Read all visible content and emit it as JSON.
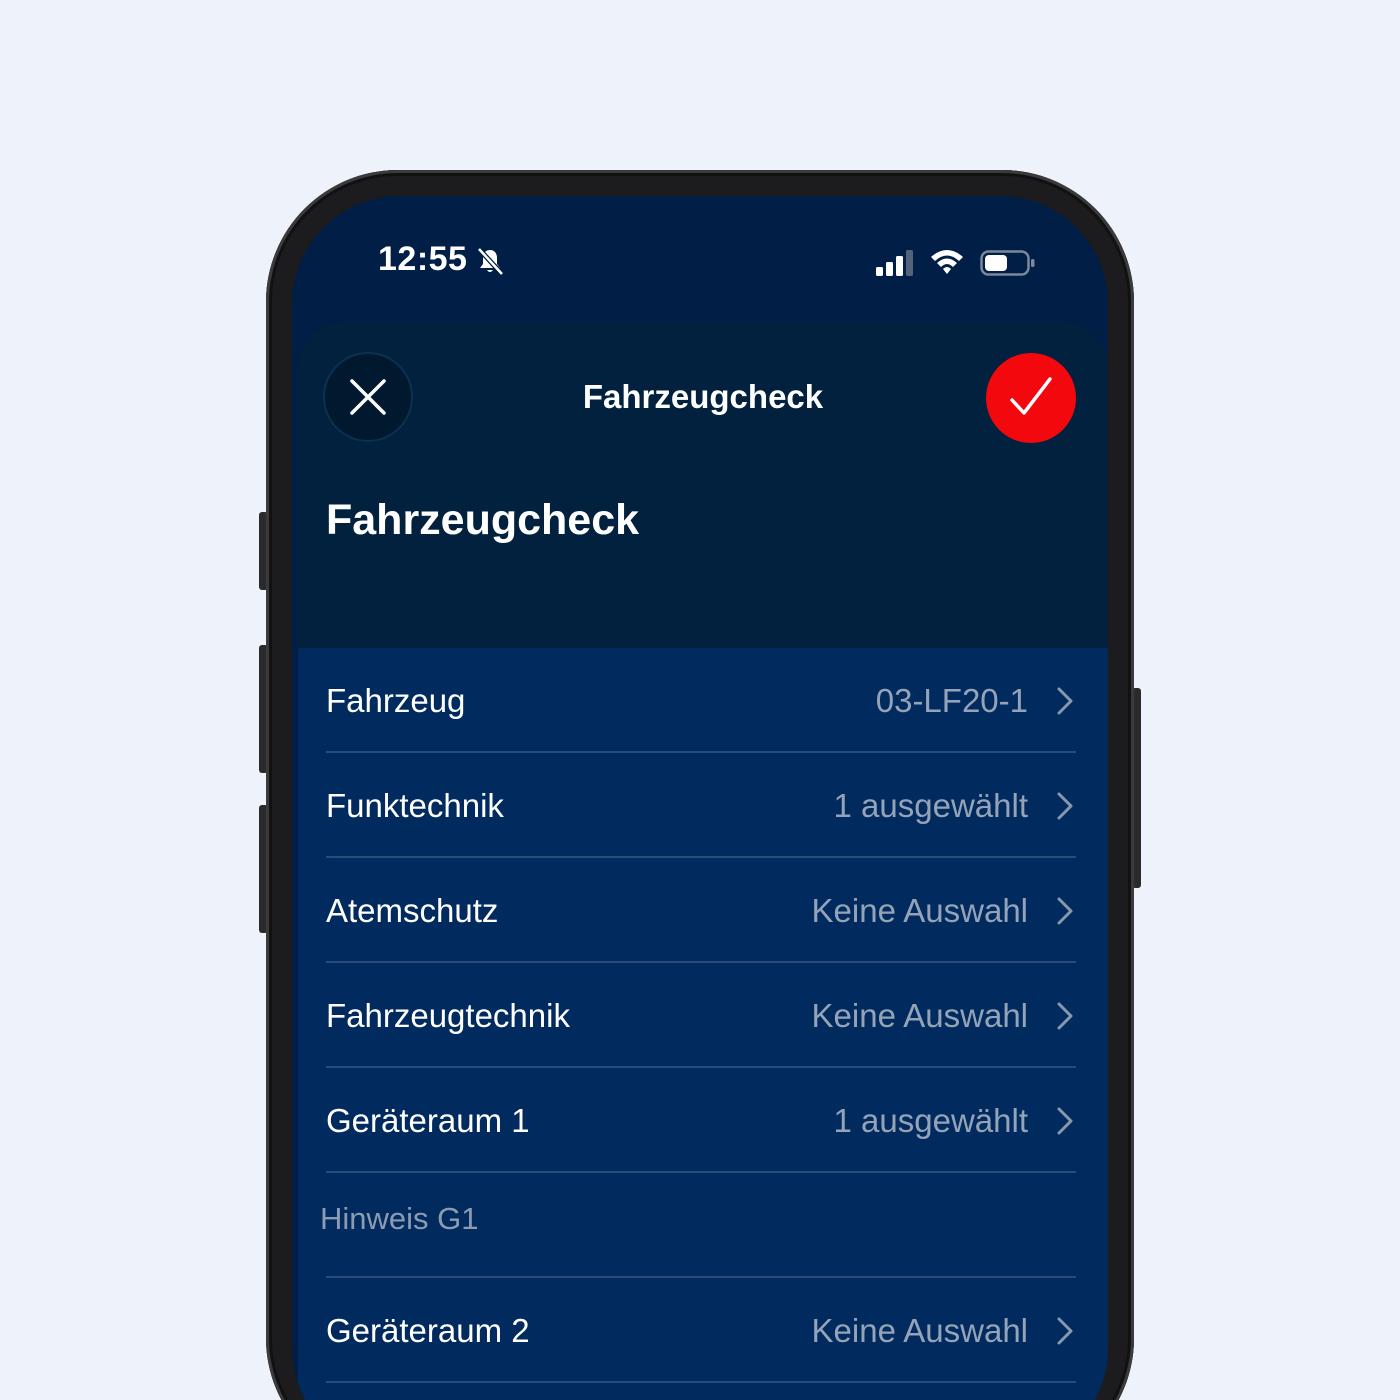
{
  "status_bar": {
    "time": "12:55"
  },
  "nav": {
    "title": "Fahrzeugcheck"
  },
  "page": {
    "title": "Fahrzeugcheck"
  },
  "rows": [
    {
      "label": "Fahrzeug",
      "value": "03-LF20-1"
    },
    {
      "label": "Funktechnik",
      "value": "1 ausgewählt"
    },
    {
      "label": "Atemschutz",
      "value": "Keine Auswahl"
    },
    {
      "label": "Fahrzeugtechnik",
      "value": "Keine Auswahl"
    },
    {
      "label": "Geräteraum 1",
      "value": "1 ausgewählt"
    }
  ],
  "note": {
    "placeholder": "Hinweis G1"
  },
  "rows2": [
    {
      "label": "Geräteraum 2",
      "value": "Keine Auswahl"
    }
  ],
  "colors": {
    "background": "#eef2fa",
    "header": "#01213e",
    "list": "#012b5e",
    "accent": "#f3080d",
    "value_text": "#95a3b8"
  }
}
